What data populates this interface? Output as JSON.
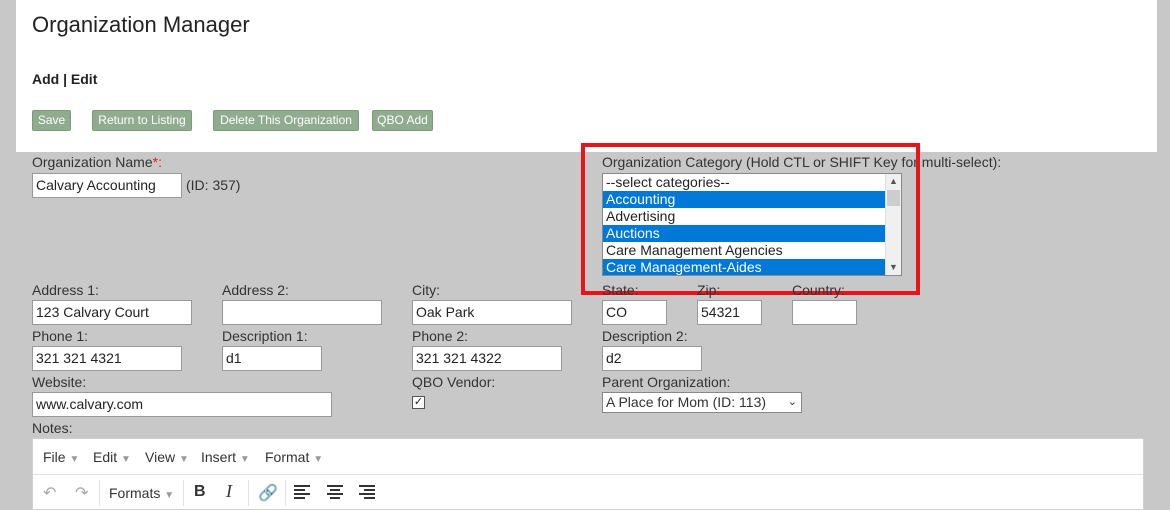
{
  "page": {
    "title": "Organization Manager",
    "mode_links": "Add | Edit"
  },
  "buttons": {
    "save": "Save",
    "return_to_listing": "Return to Listing",
    "delete": "Delete This Organization",
    "qbo_add": "QBO Add"
  },
  "form": {
    "org_name": {
      "label": "Organization Name",
      "required_mark": "*:",
      "value": "Calvary Accounting",
      "id_text": "(ID: 357)"
    },
    "category": {
      "label": "Organization Category (Hold CTL or SHIFT Key for multi-select):",
      "options": [
        {
          "label": "--select categories--",
          "selected": false
        },
        {
          "label": "Accounting",
          "selected": true
        },
        {
          "label": "Advertising",
          "selected": false
        },
        {
          "label": "Auctions",
          "selected": true
        },
        {
          "label": "Care Management Agencies",
          "selected": false
        },
        {
          "label": "Care Management-Aides",
          "selected": true
        }
      ]
    },
    "address1": {
      "label": "Address 1:",
      "value": "123 Calvary Court"
    },
    "address2": {
      "label": "Address 2:",
      "value": ""
    },
    "city": {
      "label": "City:",
      "value": "Oak Park"
    },
    "state": {
      "label": "State:",
      "value": "CO"
    },
    "zip": {
      "label": "Zip:",
      "value": "54321"
    },
    "country": {
      "label": "Country:",
      "value": ""
    },
    "phone1": {
      "label": "Phone 1:",
      "value": "321 321 4321"
    },
    "description1": {
      "label": "Description 1:",
      "value": "d1"
    },
    "phone2": {
      "label": "Phone 2:",
      "value": "321 321 4322"
    },
    "description2": {
      "label": "Description 2:",
      "value": "d2"
    },
    "website": {
      "label": "Website:",
      "value": "www.calvary.com"
    },
    "qbo_vendor": {
      "label": "QBO Vendor:",
      "checked": true,
      "check_glyph": "✓"
    },
    "parent_org": {
      "label": "Parent Organization:",
      "value": "A Place for Mom (ID: 113)"
    },
    "notes": {
      "label": "Notes:"
    }
  },
  "editor": {
    "menus": [
      "File",
      "Edit",
      "View",
      "Insert",
      "Format"
    ],
    "toolbar": {
      "formats_label": "Formats",
      "icons": [
        "undo-icon",
        "redo-icon",
        "bold-icon",
        "italic-icon",
        "link-icon",
        "align-left-icon",
        "align-center-icon",
        "align-right-icon"
      ]
    }
  },
  "colors": {
    "button_bg": "#8fac8f",
    "panel_bg": "#c8c8c8",
    "selection_bg": "#0078d7",
    "highlight_border": "#e8141b"
  }
}
